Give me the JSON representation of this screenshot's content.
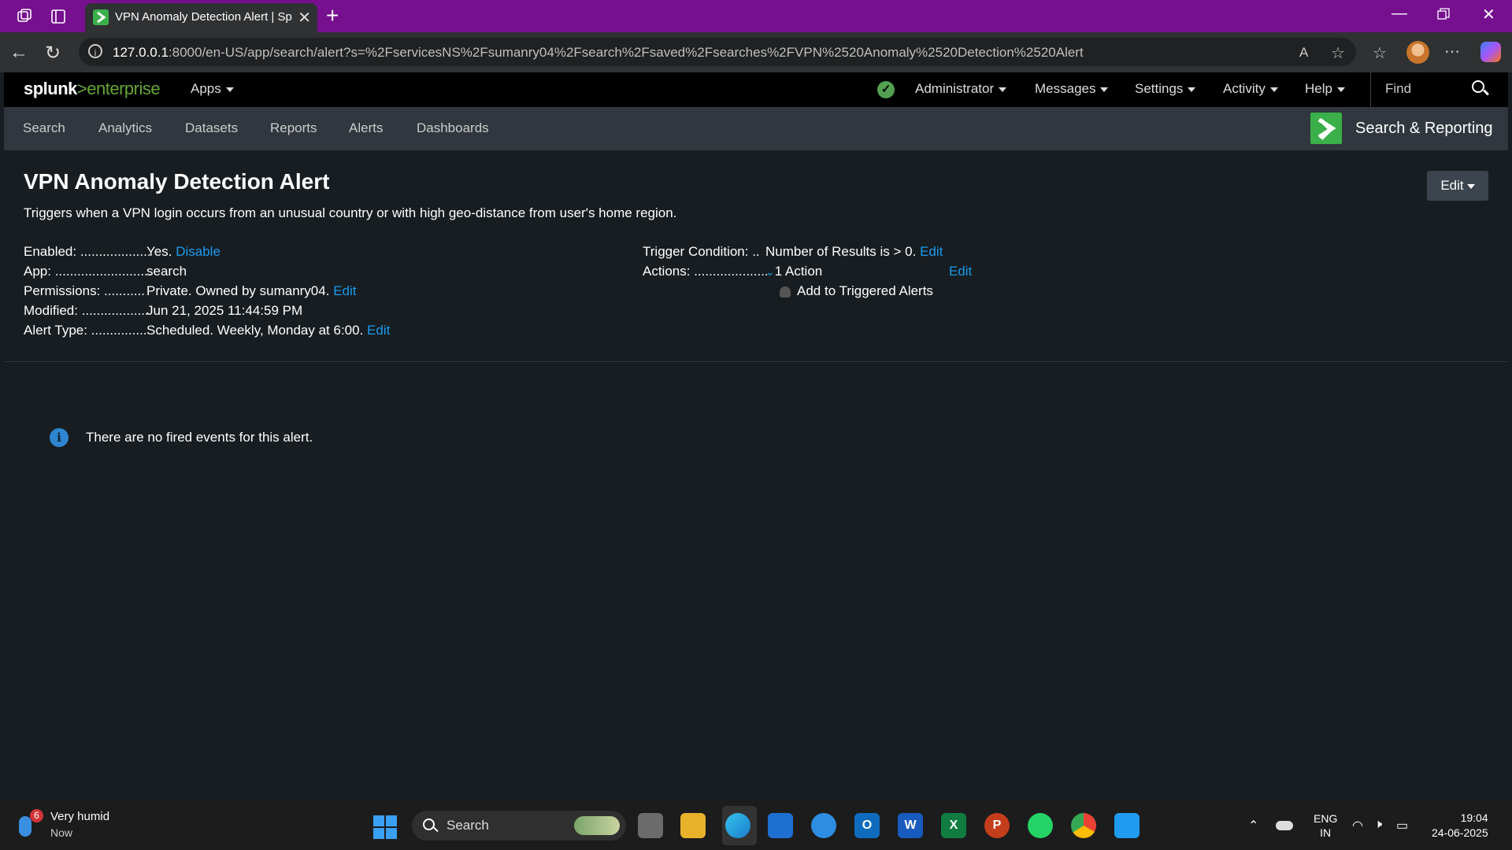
{
  "browser": {
    "tab_title": "VPN Anomaly Detection Alert | Splunk",
    "url_host": "127.0.0.1",
    "url_rest": ":8000/en-US/app/search/alert?s=%2FservicesNS%2Fsumanry04%2Fsearch%2Fsaved%2Fsearches%2FVPN%2520Anomaly%2520Detection%2520Alert"
  },
  "splunk": {
    "logo_splunk": "splunk",
    "logo_gt": ">",
    "logo_enterprise": "enterprise",
    "apps_label": "Apps",
    "top_menu": {
      "administrator": "Administrator",
      "messages": "Messages",
      "settings": "Settings",
      "activity": "Activity",
      "help": "Help",
      "find": "Find"
    },
    "nav": [
      "Search",
      "Analytics",
      "Datasets",
      "Reports",
      "Alerts",
      "Dashboards"
    ],
    "app_name": "Search & Reporting"
  },
  "alert": {
    "title": "VPN Anomaly Detection Alert",
    "description": "Triggers when a VPN login occurs from an unusual country or with high geo-distance from user's home region.",
    "edit_button": "Edit",
    "fields": {
      "enabled_key": "Enabled: ...................",
      "enabled_value": "Yes.",
      "enabled_link": "Disable",
      "app_key": "App: ..........................",
      "app_value": "search",
      "permissions_key": "Permissions: ...........",
      "permissions_value": "Private. Owned by sumanry04.",
      "permissions_link": "Edit",
      "modified_key": "Modified: ..................",
      "modified_value": "Jun 21, 2025 11:44:59 PM",
      "alert_type_key": "Alert Type: ...............",
      "alert_type_value": "Scheduled. Weekly, Monday at 6:00.",
      "alert_type_link": "Edit",
      "trigger_key": "Trigger Condition: ..",
      "trigger_value": "Number of Results is > 0.",
      "trigger_link": "Edit",
      "actions_key": "Actions: ....................",
      "actions_value": "1 Action",
      "actions_link": "Edit",
      "action_item": "Add to Triggered Alerts"
    },
    "no_events": "There are no fired events for this alert."
  },
  "taskbar": {
    "weather_badge": "6",
    "weather_title": "Very humid",
    "weather_sub": "Now",
    "search": "Search",
    "lang_1": "ENG",
    "lang_2": "IN",
    "time": "19:04",
    "date": "24-06-2025"
  }
}
